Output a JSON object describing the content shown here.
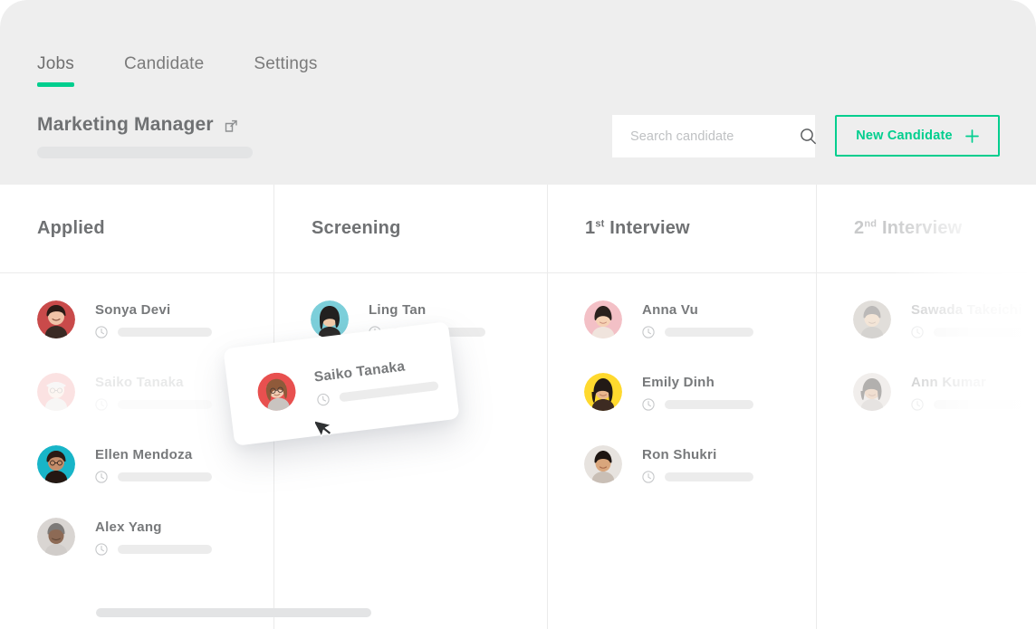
{
  "header": {
    "tabs": [
      {
        "label": "Jobs",
        "active": true
      },
      {
        "label": "Candidate",
        "active": false
      },
      {
        "label": "Settings",
        "active": false
      }
    ],
    "job_title": "Marketing Manager",
    "external_link_icon": "external-link-icon",
    "search": {
      "placeholder": "Search candidate",
      "value": "",
      "icon": "search-icon"
    },
    "new_candidate": {
      "label": "New Candidate",
      "icon": "plus-icon"
    }
  },
  "colors": {
    "accent_green": "#00ce8e",
    "header_bg": "#eeeeee",
    "board_bg": "#ffffff",
    "text_grey": "#6f7173",
    "divider": "#ebebeb",
    "placeholder_bar": "#ececec"
  },
  "board": {
    "columns": [
      {
        "title": "Applied",
        "title_prefix": "",
        "title_sup": "",
        "dimmed": false,
        "cards": [
          {
            "name": "Sonya Devi",
            "avatar_bg": "#c94a4a",
            "ghost": false
          },
          {
            "name": "Saiko Tanaka",
            "avatar_bg": "#e8504f",
            "ghost": true
          },
          {
            "name": "Ellen Mendoza",
            "avatar_bg": "#18b5c8",
            "ghost": false
          },
          {
            "name": "Alex Yang",
            "avatar_bg": "#d9d5d2",
            "ghost": false
          }
        ]
      },
      {
        "title": "Screening",
        "title_prefix": "",
        "title_sup": "",
        "dimmed": false,
        "cards": [
          {
            "name": "Ling Tan",
            "avatar_bg": "#7ccfda",
            "ghost": false
          }
        ]
      },
      {
        "title": "Interview",
        "title_prefix": "1",
        "title_sup": "st",
        "dimmed": false,
        "cards": [
          {
            "name": "Anna Vu",
            "avatar_bg": "#f3c0c6",
            "ghost": false
          },
          {
            "name": "Emily Dinh",
            "avatar_bg": "#ffd92e",
            "ghost": false
          },
          {
            "name": "Ron Shukri",
            "avatar_bg": "#e7e3df",
            "ghost": false
          }
        ]
      },
      {
        "title": "Interview",
        "title_prefix": "2",
        "title_sup": "nd",
        "dimmed": true,
        "cards": [
          {
            "name": "Sawada Takeichi",
            "avatar_bg": "#b9b2a8",
            "ghost": false
          },
          {
            "name": "Ann Kumar",
            "avatar_bg": "#ded8d2",
            "ghost": false
          }
        ]
      }
    ],
    "card_meta_icon": "clock-icon"
  },
  "drag_card": {
    "name": "Saiko Tanaka",
    "avatar_bg": "#e8504f",
    "meta_icon": "clock-icon"
  },
  "cursor": "mouse-cursor-arrow",
  "scrollbar": "horizontal-scrollbar"
}
